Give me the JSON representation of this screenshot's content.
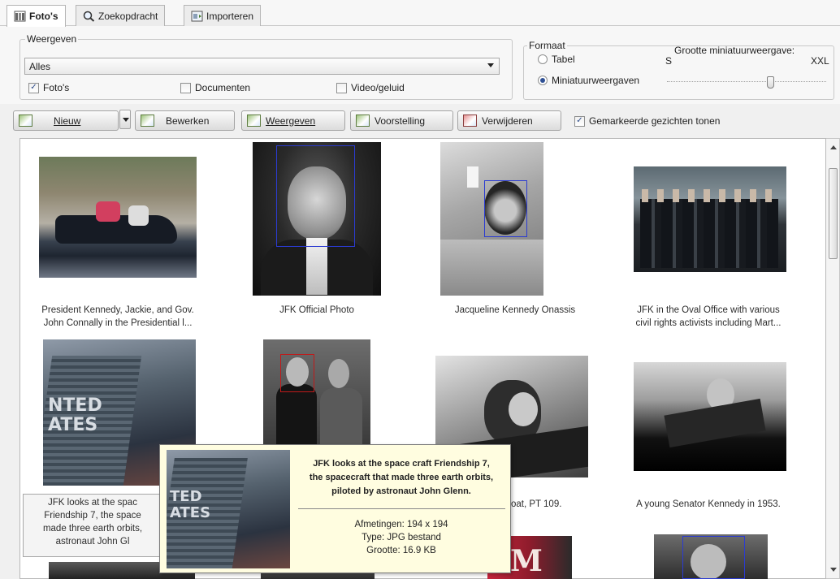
{
  "tabs": [
    {
      "label": "Foto's",
      "active": true
    },
    {
      "label": "Zoekopdracht",
      "active": false
    },
    {
      "label": "Importeren",
      "active": false
    }
  ],
  "view": {
    "legend": "Weergeven",
    "select_value": "Alles",
    "checkboxes": [
      {
        "label": "Foto's",
        "checked": true
      },
      {
        "label": "Documenten",
        "checked": false
      },
      {
        "label": "Video/geluid",
        "checked": false
      }
    ]
  },
  "format": {
    "legend": "Formaat",
    "options": [
      {
        "label": "Tabel",
        "selected": false
      },
      {
        "label": "Miniatuurweergaven",
        "selected": true
      }
    ],
    "size_label": "Grootte miniatuurweergave:",
    "size_min": "S",
    "size_max": "XXL",
    "size_level": 0.68
  },
  "toolbar": {
    "new_label": "Nieuw",
    "edit_label": "Bewerken",
    "view_label": "Weergeven",
    "slideshow_label": "Voorstelling",
    "delete_label": "Verwijderen",
    "faces_label": "Gemarkeerde gezichten tonen",
    "faces_checked": true
  },
  "photos": [
    {
      "caption_1": "President Kennedy, Jackie, and Gov.",
      "caption_2": "John Connally in the Presidential l..."
    },
    {
      "caption_1": "JFK Official Photo",
      "caption_2": ""
    },
    {
      "caption_1": "Jacqueline Kennedy Onassis",
      "caption_2": ""
    },
    {
      "caption_1": "JFK in the Oval Office with various",
      "caption_2": "civil rights activists including Mart..."
    },
    {
      "caption_1": "JFK looks at the spac",
      "caption_2": "Friendship 7, the space",
      "caption_3": "made three earth orbits,",
      "caption_4": "astronaut John Gl"
    },
    {
      "caption_1": "",
      "caption_2": ""
    },
    {
      "caption_1": "atrol boat, PT 109.",
      "caption_2": ""
    },
    {
      "caption_1": "A young Senator Kennedy in 1953.",
      "caption_2": ""
    }
  ],
  "tooltip": {
    "title_1": "JFK looks at the space craft Friendship 7,",
    "title_2": "the spacecraft that made three earth orbits,",
    "title_3": "piloted by astronaut John Glenn.",
    "dimensions": "Afmetingen: 194 x 194",
    "type": "Type: JPG bestand",
    "size": "Grootte: 16.9 KB"
  },
  "colors": {
    "face_box": "#2b3bd1",
    "face_box_alt": "#c01a1a",
    "tooltip_bg": "#fffde0"
  }
}
